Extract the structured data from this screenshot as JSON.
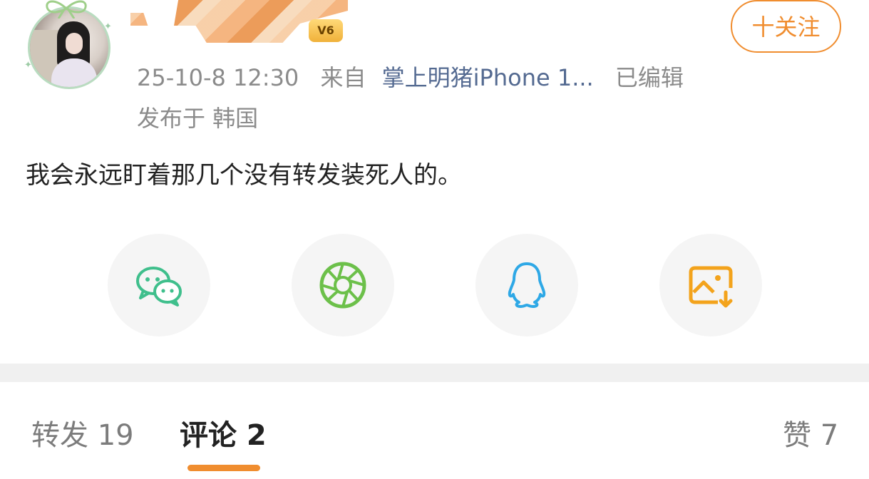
{
  "post": {
    "follow_label": "十关注",
    "vip_label": "V6",
    "timestamp": "25-10-8 12:30",
    "source_prefix": "来自",
    "source_name": "掌上明猪iPhone 1...",
    "edited_label": "已编辑",
    "location": "发布于 韩国",
    "text": "我会永远盯着那几个没有转发装死人的。"
  },
  "share": {
    "items": [
      {
        "icon": "wechat-icon",
        "color": "#3fbf8c"
      },
      {
        "icon": "moments-icon",
        "color": "#6cc04a"
      },
      {
        "icon": "qq-icon",
        "color": "#2ea8e6"
      },
      {
        "icon": "save-image-icon",
        "color": "#f3a31c"
      }
    ]
  },
  "tabs": {
    "repost": "转发 19",
    "comments": "评论 2",
    "likes": "赞 7"
  },
  "colors": {
    "accent": "#f08d2f",
    "source_link": "#546a91",
    "muted_text": "#8b8b8b"
  }
}
